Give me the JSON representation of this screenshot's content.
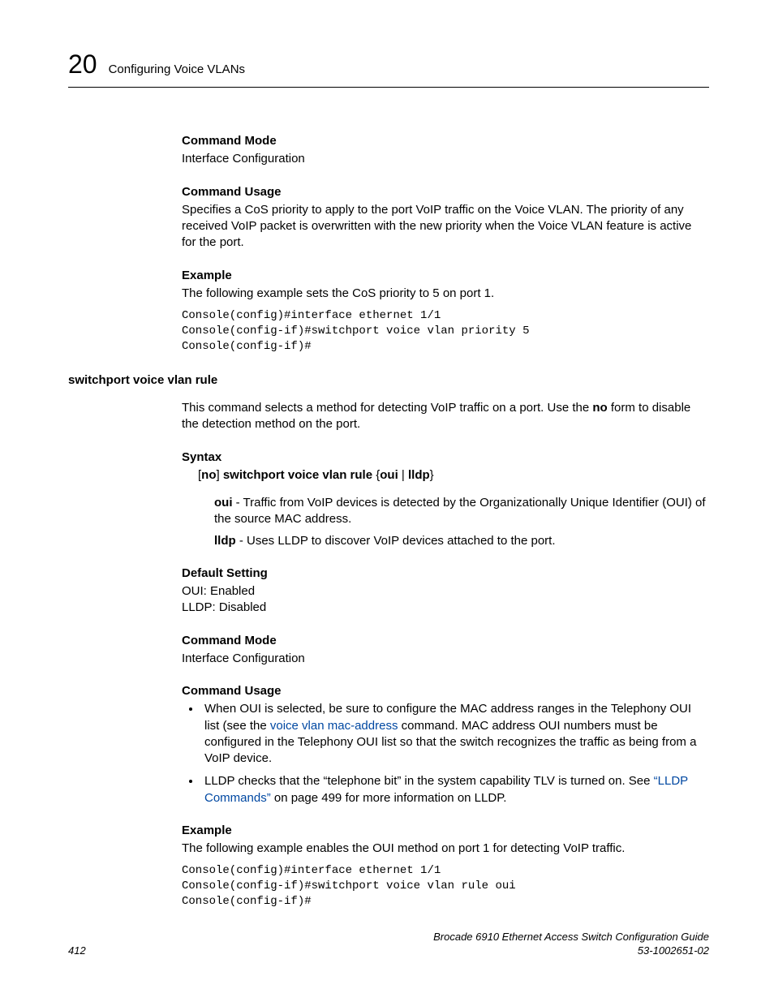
{
  "header": {
    "chapter_number": "20",
    "chapter_title": "Configuring Voice VLANs"
  },
  "section1": {
    "cmd_mode_head": "Command Mode",
    "cmd_mode_text": "Interface Configuration",
    "cmd_usage_head": "Command Usage",
    "cmd_usage_text": "Specifies a CoS priority to apply to the port VoIP traffic on the Voice VLAN. The priority of any received VoIP packet is overwritten with the new priority when the Voice VLAN feature is active for the port.",
    "example_head": "Example",
    "example_intro": "The following example sets the CoS priority to 5 on port 1.",
    "example_code": "Console(config)#interface ethernet 1/1\nConsole(config-if)#switchport voice vlan priority 5\nConsole(config-if)#"
  },
  "cmd2": {
    "name": "switchport voice vlan rule",
    "desc_pre": "This command selects a method for detecting VoIP traffic on a port. Use the ",
    "desc_bold": "no",
    "desc_post": " form to disable the detection method on the port.",
    "syntax_head": "Syntax",
    "syntax_line_pre": "[",
    "syntax_line_no": "no",
    "syntax_line_mid": "] ",
    "syntax_line_cmd": "switchport voice vlan rule",
    "syntax_line_bracket_open": " {",
    "syntax_line_oui": "oui",
    "syntax_line_pipe": " | ",
    "syntax_line_lldp": "lldp",
    "syntax_line_bracket_close": "}",
    "oui_label": "oui",
    "oui_text": " - Traffic from VoIP devices is detected by the Organizationally Unique Identifier (OUI) of the source MAC address.",
    "lldp_label": "lldp",
    "lldp_text": " - Uses LLDP to discover VoIP devices attached to the port.",
    "default_head": "Default Setting",
    "default_line1": "OUI: Enabled",
    "default_line2": "LLDP: Disabled",
    "cmd_mode_head": "Command Mode",
    "cmd_mode_text": "Interface Configuration",
    "cmd_usage_head": "Command Usage",
    "bullet1_pre": "When OUI is selected, be sure to configure the MAC address ranges in the Telephony OUI list (see the ",
    "bullet1_link": "voice vlan mac-address",
    "bullet1_post": " command. MAC address OUI numbers must be configured in the Telephony OUI list so that the switch recognizes the traffic as being from a VoIP device.",
    "bullet2_pre": "LLDP checks that the “telephone bit” in the system capability TLV is turned on. See ",
    "bullet2_link": "“LLDP Commands”",
    "bullet2_post": " on page 499 for more information on LLDP.",
    "example_head": "Example",
    "example_intro": "The following example enables the OUI method on port 1 for detecting VoIP traffic.",
    "example_code": "Console(config)#interface ethernet 1/1\nConsole(config-if)#switchport voice vlan rule oui\nConsole(config-if)#"
  },
  "footer": {
    "page_number": "412",
    "doc_title": "Brocade 6910 Ethernet Access Switch Configuration Guide",
    "doc_id": "53-1002651-02"
  }
}
